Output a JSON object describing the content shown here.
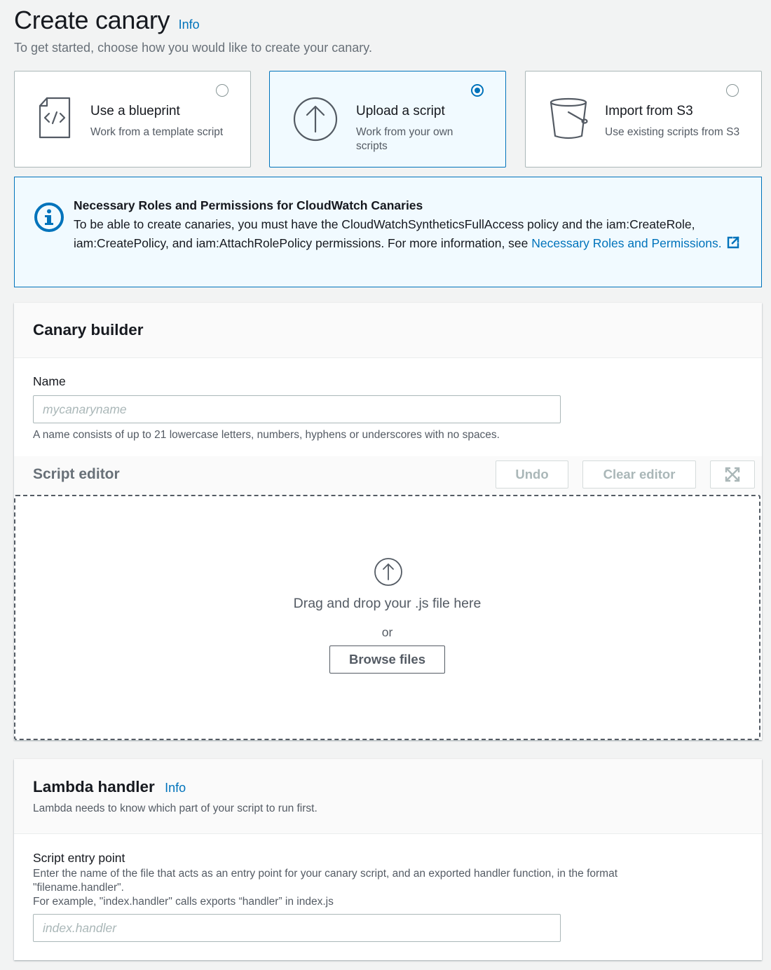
{
  "header": {
    "title": "Create canary",
    "info_label": "Info",
    "subtitle": "To get started, choose how you would like to create your canary."
  },
  "creation_options": [
    {
      "title": "Use a blueprint",
      "description": "Work from a template script",
      "selected": false,
      "icon": "code-file-icon"
    },
    {
      "title": "Upload a script",
      "description": "Work from your own scripts",
      "selected": true,
      "icon": "upload-icon"
    },
    {
      "title": "Import from S3",
      "description": "Use existing scripts from S3",
      "selected": false,
      "icon": "bucket-icon"
    }
  ],
  "alert": {
    "title": "Necessary Roles and Permissions for CloudWatch Canaries",
    "body": "To be able to create canaries, you must have the CloudWatchSyntheticsFullAccess policy and the iam:CreateRole, iam:CreatePolicy, and iam:AttachRolePolicy permissions. For more information, see ",
    "link_label": "Necessary Roles and Permissions."
  },
  "canary_builder": {
    "title": "Canary builder",
    "name_label": "Name",
    "name_value": "",
    "name_placeholder": "mycanaryname",
    "name_hint": "A name consists of up to 21 lowercase letters, numbers, hyphens or underscores with no spaces.",
    "script_editor": {
      "title": "Script editor",
      "undo_label": "Undo",
      "clear_label": "Clear editor",
      "dropzone_text": "Drag and drop your .js file here",
      "or_text": "or",
      "browse_label": "Browse files"
    }
  },
  "lambda_handler": {
    "title": "Lambda handler",
    "info_label": "Info",
    "description": "Lambda needs to know which part of your script to run first.",
    "entry_label": "Script entry point",
    "entry_hint_1": "Enter the name of the file that acts as an entry point for your canary script, and an exported handler function, in the format \"filename.handler\".",
    "entry_hint_2": "For example, \"index.handler\" calls exports “handler” in index.js",
    "entry_value": "",
    "entry_placeholder": "index.handler"
  },
  "colors": {
    "accent": "#0073bb",
    "selected_bg": "#f1faff",
    "border": "#aab7b8",
    "text_secondary": "#545b64"
  }
}
